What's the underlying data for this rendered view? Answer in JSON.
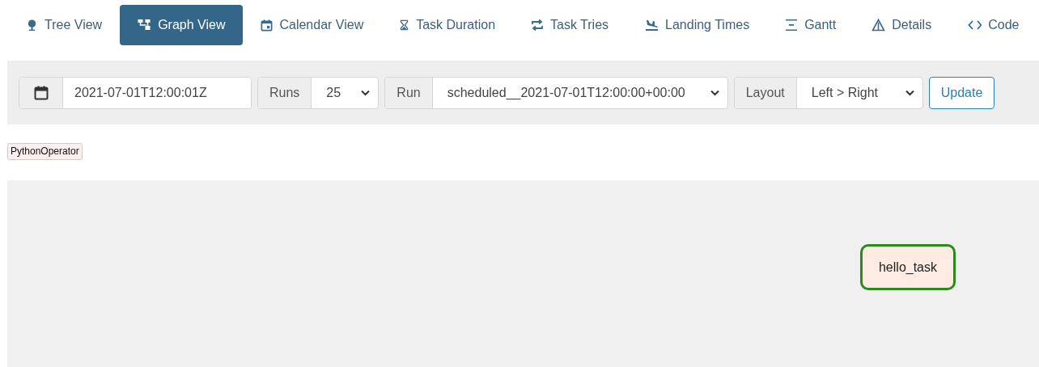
{
  "tabs": [
    {
      "label": "Tree View",
      "selected": false
    },
    {
      "label": "Graph View",
      "selected": true
    },
    {
      "label": "Calendar View",
      "selected": false
    },
    {
      "label": "Task Duration",
      "selected": false
    },
    {
      "label": "Task Tries",
      "selected": false
    },
    {
      "label": "Landing Times",
      "selected": false
    },
    {
      "label": "Gantt",
      "selected": false
    },
    {
      "label": "Details",
      "selected": false
    },
    {
      "label": "Code",
      "selected": false
    }
  ],
  "toolbar": {
    "date": {
      "value": "2021-07-01T12:00:01Z"
    },
    "runs": {
      "label": "Runs",
      "value": "25"
    },
    "run": {
      "label": "Run",
      "value": "scheduled__2021-07-01T12:00:00+00:00"
    },
    "layout": {
      "label": "Layout",
      "value": "Left > Right"
    },
    "update_button": "Update"
  },
  "legend": [
    {
      "label": "PythonOperator"
    }
  ],
  "graph": {
    "nodes": [
      {
        "label": "hello_task",
        "color": "#2a8a1e"
      }
    ]
  }
}
